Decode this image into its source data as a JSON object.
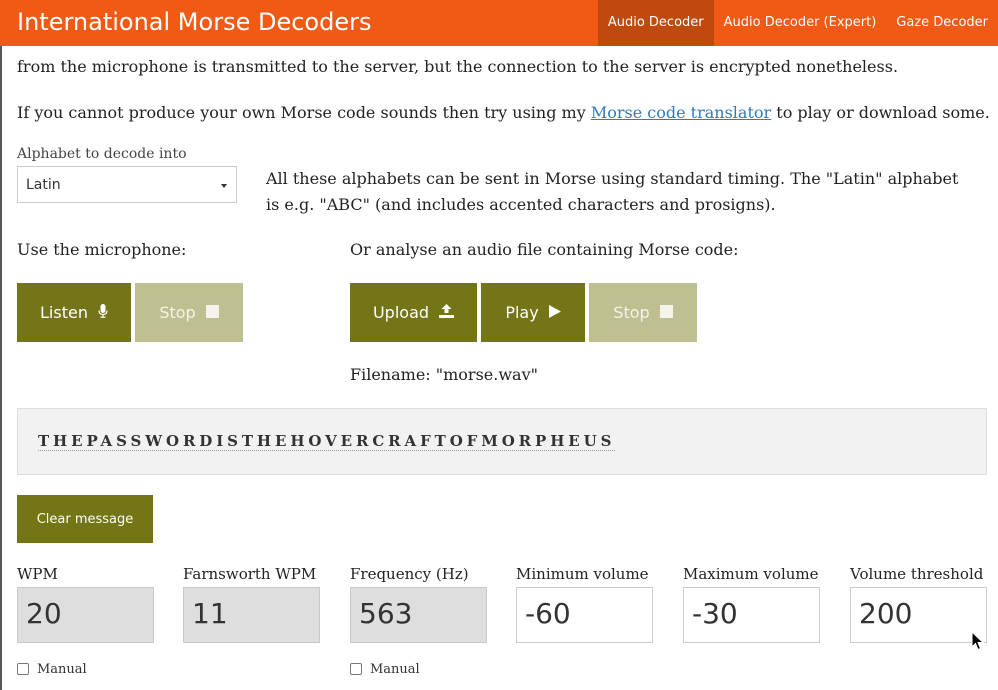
{
  "header": {
    "title": "International Morse Decoders",
    "nav": [
      "Audio Decoder",
      "Audio Decoder (Expert)",
      "Gaze Decoder"
    ],
    "accent": "#f05a14"
  },
  "intro": {
    "line1": "from the microphone is transmitted to the server, but the connection to the server is encrypted nonetheless.",
    "line2_pre": "If you cannot produce your own Morse code sounds then try using my ",
    "line2_link": "Morse code translator",
    "line2_post": " to play or download some."
  },
  "alphabet": {
    "label": "Alphabet to decode into",
    "selected": "Latin",
    "note": "All these alphabets can be sent in Morse using standard timing. The \"Latin\" alphabet is e.g. \"ABC\" (and includes accented characters and prosigns)."
  },
  "microphone": {
    "label": "Use the microphone:",
    "listen_label": "Listen",
    "listen_icon": "microphone-icon",
    "stop_label": "Stop",
    "stop_icon": "stop-icon"
  },
  "audio_file": {
    "label": "Or analyse an audio file containing Morse code:",
    "upload_label": "Upload",
    "upload_icon": "upload-icon",
    "play_label": "Play",
    "play_icon": "play-icon",
    "stop_label": "Stop",
    "stop_icon": "stop-icon",
    "filename": "Filename: \"morse.wav\""
  },
  "output": {
    "message": "THEPASSWORDISTHEHOVERCRAFTOFMORPHEUS"
  },
  "clear_label": "Clear message",
  "settings": {
    "wpm_label": "WPM",
    "wpm_value": "20",
    "farnsworth_label": "Farnsworth WPM",
    "farnsworth_value": "11",
    "frequency_label": "Frequency (Hz)",
    "frequency_value": "563",
    "min_volume_label": "Minimum volume",
    "min_volume_value": "-60",
    "max_volume_label": "Maximum volume",
    "max_volume_value": "-30",
    "threshold_label": "Volume threshold",
    "threshold_value": "200",
    "manual_label": "Manual"
  },
  "colors": {
    "button_primary": "#737516",
    "button_disabled": "#bfc091"
  }
}
